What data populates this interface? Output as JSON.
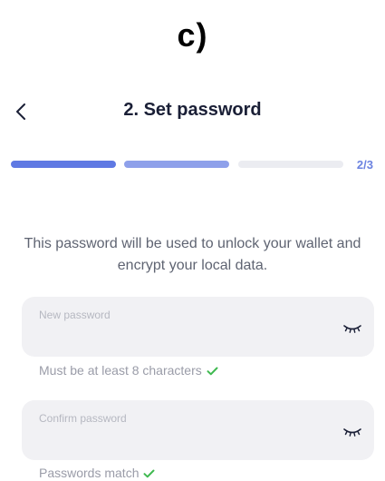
{
  "panel_label": "c)",
  "header": {
    "title": "2. Set password",
    "back_icon": "chevron-left-icon"
  },
  "progress": {
    "step_label": "2/3",
    "current_step": 2,
    "total_steps": 3,
    "colors": {
      "done": "#5f79e3",
      "current": "#8ea0ea",
      "pending": "#ebecf1"
    }
  },
  "description": "This password will be used to unlock your wallet and encrypt your local data.",
  "fields": {
    "new_password": {
      "placeholder": "New password",
      "value": "",
      "toggle_icon": "eye-closed-icon",
      "hint": "Must be at least 8 characters",
      "hint_icon": "check-icon"
    },
    "confirm_password": {
      "placeholder": "Confirm password",
      "value": "",
      "toggle_icon": "eye-closed-icon",
      "hint": "Passwords match",
      "hint_icon": "check-icon"
    }
  },
  "colors": {
    "accent": "#6b82e0",
    "success": "#3fb950",
    "field_background": "#f1f1f4"
  }
}
